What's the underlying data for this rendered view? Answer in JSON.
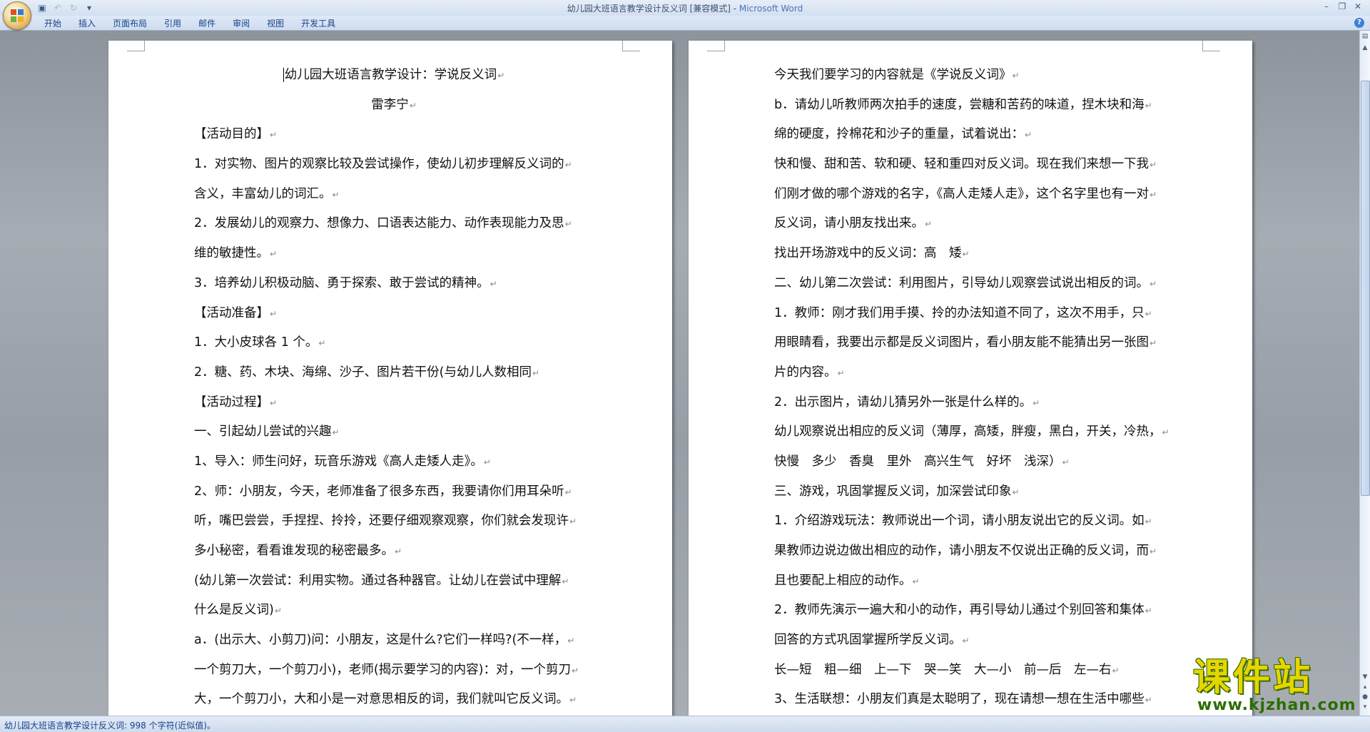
{
  "window": {
    "title_doc": "幼儿园大班语言教学设计反义词 [兼容模式] - ",
    "title_app": "Microsoft Word"
  },
  "ribbon": {
    "tabs": [
      "开始",
      "插入",
      "页面布局",
      "引用",
      "邮件",
      "审阅",
      "视图",
      "开发工具"
    ]
  },
  "status": {
    "text": "幼儿园大班语言教学设计反义词: 998 个字符(近似值)。"
  },
  "watermark": {
    "main": "课件站",
    "url": "www.kjzhan.com"
  },
  "page1": {
    "paragraphs": [
      "幼儿园大班语言教学设计：学说反义词",
      "雷李宁",
      "【活动目的】",
      "1．对实物、图片的观察比较及尝试操作，使幼儿初步理解反义词的",
      "含义，丰富幼儿的词汇。",
      "2．发展幼儿的观察力、想像力、口语表达能力、动作表现能力及思",
      "维的敏捷性。",
      "3．培养幼儿积极动脑、勇于探索、敢于尝试的精神。",
      "【活动准备】",
      "1．大小皮球各 1 个。",
      "2．糖、药、木块、海绵、沙子、图片若干份(与幼儿人数相同",
      "【活动过程】",
      "一、引起幼儿尝试的兴趣",
      "1、导入：师生问好，玩音乐游戏《高人走矮人走》。",
      "2、师：小朋友，今天，老师准备了很多东西，我要请你们用耳朵听",
      "听，嘴巴尝尝，手捏捏、拎拎，还要仔细观察观察，你们就会发现许",
      "多小秘密，看看谁发现的秘密最多。",
      "(幼儿第一次尝试：利用实物。通过各种器官。让幼儿在尝试中理解",
      "什么是反义词)",
      "a．(出示大、小剪刀)问：小朋友，这是什么?它们一样吗?(不一样，",
      "一个剪刀大，一个剪刀小)，老师(揭示要学习的内容)：对，一个剪刀",
      "大，一个剪刀小，大和小是一对意思相反的词，我们就叫它反义词。"
    ]
  },
  "page2": {
    "paragraphs": [
      "今天我们要学习的内容就是《学说反义词》",
      "b．请幼儿听教师两次拍手的速度，尝糖和苦药的味道，捏木块和海",
      "绵的硬度，拎棉花和沙子的重量，试着说出：",
      "快和慢、甜和苦、软和硬、轻和重四对反义词。现在我们来想一下我",
      "们刚才做的哪个游戏的名字，《高人走矮人走》，这个名字里也有一对",
      "反义词，请小朋友找出来。",
      "找出开场游戏中的反义词：高　矮",
      "二、幼儿第二次尝试：利用图片，引导幼儿观察尝试说出相反的词。",
      "1．教师：刚才我们用手摸、拎的办法知道不同了，这次不用手，只",
      "用眼睛看，我要出示都是反义词图片，看小朋友能不能猜出另一张图",
      "片的内容。",
      "2．出示图片，请幼儿猜另外一张是什么样的。",
      "幼儿观察说出相应的反义词（薄厚，高矮，胖瘦，黑白，开关，冷热，",
      "快慢　多少　香臭　里外　高兴生气　好坏　浅深）",
      "三、游戏，巩固掌握反义词，加深尝试印象",
      "1．介绍游戏玩法：教师说出一个词，请小朋友说出它的反义词。如",
      "果教师边说边做出相应的动作，请小朋友不仅说出正确的反义词，而",
      "且也要配上相应的动作。",
      "2．教师先演示一遍大和小的动作，再引导幼儿通过个别回答和集体",
      "回答的方式巩固掌握所学反义词。",
      "长—短　粗—细　上—下　哭—笑　大—小　前—后　左—右",
      "3、生活联想：小朋友们真是太聪明了，现在请想一想在生活中哪些"
    ]
  }
}
